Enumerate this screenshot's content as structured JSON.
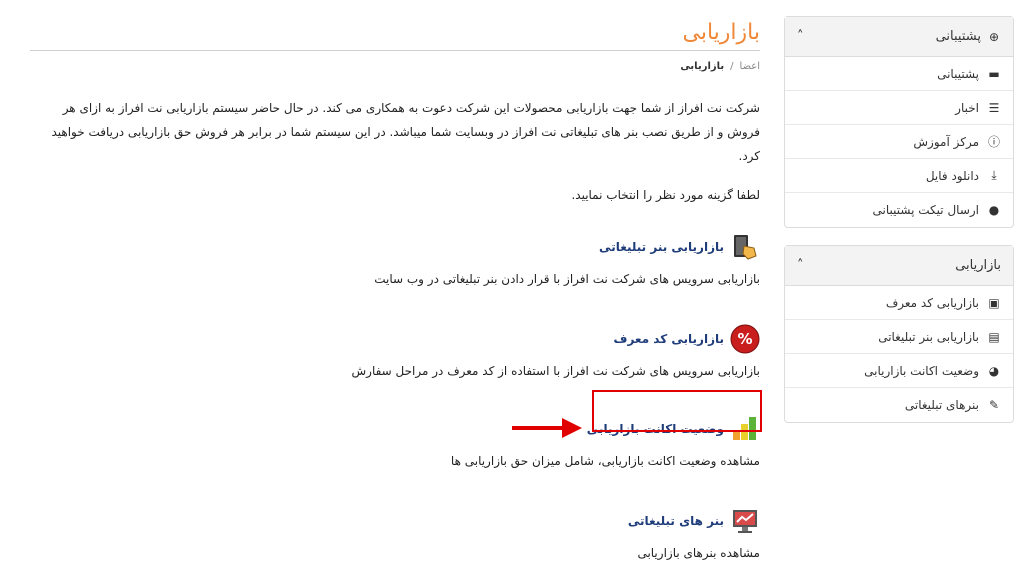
{
  "page": {
    "title": "بازاریابی",
    "breadcrumb": [
      "اعضا",
      "بازاریابی"
    ],
    "intro": "شرکت نت افراز از شما جهت بازاریابی محصولات این شرکت دعوت به همکاری می کند. در حال حاضر سیستم بازاریابی نت افراز به ازای هر فروش و از طریق نصب بنر های تبلیغاتی نت افراز در وبسایت شما میباشد. در این سیستم شما در برابر هر فروش حق بازاریابی دریافت خواهید کرد.",
    "prompt": "لطفا گزینه مورد نظر را انتخاب نمایید."
  },
  "sections": [
    {
      "title": "بازاریابی بنر تبلیغاتی",
      "desc": "بازاریابی سرویس های شرکت نت افراز با قرار دادن بنر تبلیغاتی در وب سایت",
      "icon": "banner-hand-icon"
    },
    {
      "title": "بازاریابی کد معرف",
      "desc": "بازاریابی سرویس های شرکت نت افراز با استفاده از کد معرف در مراحل سفارش",
      "icon": "percent-icon"
    },
    {
      "title": "وضعیت اکانت بازاریابی",
      "desc": "مشاهده وضعیت اکانت بازاریابی، شامل میزان حق بازاریابی ها",
      "icon": "bar-chart-icon"
    },
    {
      "title": "بنر های تبلیغاتی",
      "desc": "مشاهده بنرهای بازاریابی",
      "icon": "monitor-chart-icon"
    }
  ],
  "sidebar": {
    "support": {
      "title": "پشتیبانی",
      "items": [
        {
          "label": "پشتیبانی",
          "icon": "ticket-icon"
        },
        {
          "label": "اخبار",
          "icon": "list-icon"
        },
        {
          "label": "مرکز آموزش",
          "icon": "info-icon"
        },
        {
          "label": "دانلود فایل",
          "icon": "download-icon"
        },
        {
          "label": "ارسال تیکت پشتیبانی",
          "icon": "comments-icon"
        }
      ]
    },
    "marketing": {
      "title": "بازاریابی",
      "items": [
        {
          "label": "بازاریابی کد معرف",
          "icon": "id-card-icon"
        },
        {
          "label": "بازاریابی بنر تبلیغاتی",
          "icon": "money-icon"
        },
        {
          "label": "وضعیت اکانت بازاریابی",
          "icon": "pie-chart-icon"
        },
        {
          "label": "بنرهای تبلیغاتی",
          "icon": "brush-icon"
        }
      ]
    }
  },
  "colors": {
    "title": "#f0883a",
    "link": "#1f3d7a",
    "highlight": "#e00000"
  }
}
